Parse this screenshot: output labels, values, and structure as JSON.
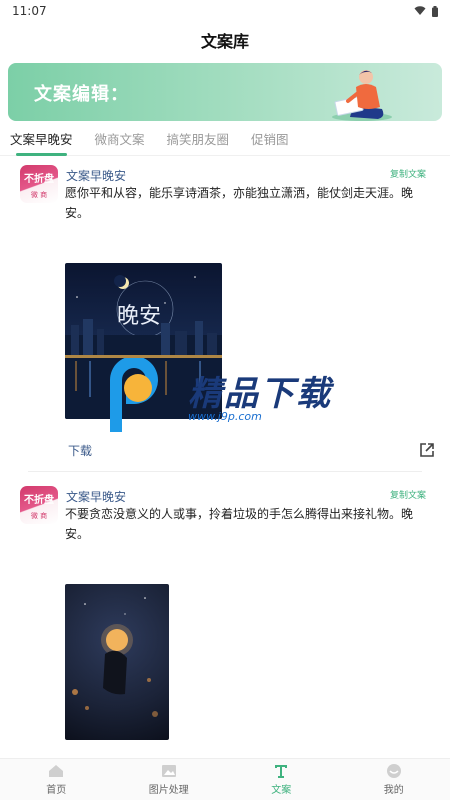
{
  "status": {
    "time": "11:07"
  },
  "header": {
    "title": "文案库"
  },
  "banner": {
    "text": "文案编辑："
  },
  "tabs": [
    {
      "label": "文案早晚安",
      "active": true
    },
    {
      "label": "微商文案",
      "active": false
    },
    {
      "label": "搞笑朋友圈",
      "active": false
    },
    {
      "label": "促销图",
      "active": false
    }
  ],
  "posts": [
    {
      "avatar_top": "不折盘",
      "avatar_bottom": "微 商",
      "author": "文案早晚安",
      "copy_label": "复制文案",
      "text": "愿你平和从容，能乐享诗酒茶，亦能独立潇洒，能仗剑走天涯。晚安。",
      "image_caption": "晚安",
      "download_label": "下载"
    },
    {
      "avatar_top": "不折盘",
      "avatar_bottom": "微 商",
      "author": "文案早晚安",
      "copy_label": "复制文案",
      "text": "不要贪恋没意义的人或事，拎着垃圾的手怎么腾得出来接礼物。晚安。"
    }
  ],
  "watermark": {
    "text": "精品下载",
    "url": "www.j9p.com"
  },
  "bottom_nav": [
    {
      "label": "首页",
      "icon": "home-icon",
      "active": false
    },
    {
      "label": "图片处理",
      "icon": "image-icon",
      "active": false
    },
    {
      "label": "文案",
      "icon": "text-icon",
      "active": true
    },
    {
      "label": "我的",
      "icon": "profile-icon",
      "active": false
    }
  ],
  "colors": {
    "accent": "#3fb27f",
    "link": "#3b5a8a"
  }
}
